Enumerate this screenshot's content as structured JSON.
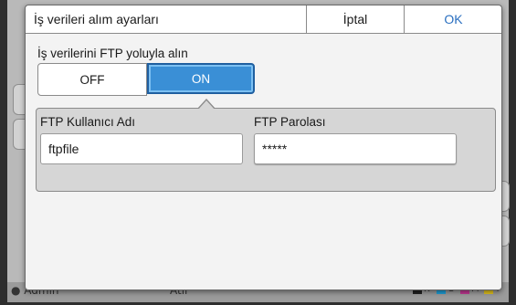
{
  "dialog": {
    "title": "İş verileri alım ayarları",
    "cancel_label": "İptal",
    "ok_label": "OK"
  },
  "ftp_receive": {
    "label": "İş verilerini FTP yoluyla alın",
    "off_label": "OFF",
    "on_label": "ON",
    "selected": "ON"
  },
  "ftp_username": {
    "label": "FTP Kullanıcı Adı",
    "value": "ftpfile"
  },
  "ftp_password": {
    "label": "FTP Parolası",
    "value": "*****"
  },
  "background": {
    "footer_user": "Admin",
    "footer_text": "Atıl",
    "ink_labels": [
      "K",
      "C",
      "M",
      "Y"
    ]
  },
  "colors": {
    "accent": "#3a8fd6",
    "ok_text": "#2a6fc0"
  }
}
